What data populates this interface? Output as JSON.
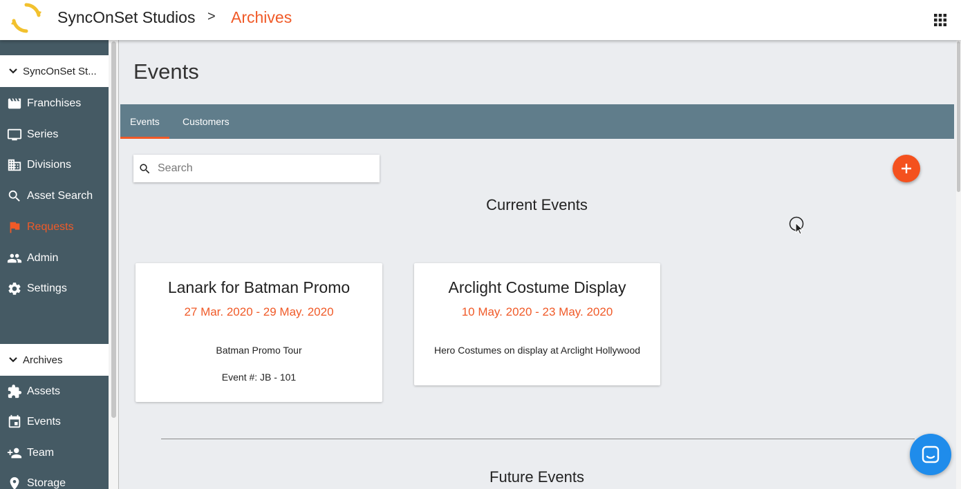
{
  "header": {
    "org_name": "SyncOnSet Studios",
    "separator": ">",
    "current_section": "Archives",
    "apps_icon": "apps-grid-icon",
    "accent_color": "#f05a28"
  },
  "sidebar": {
    "org_section": {
      "label": "SyncOnSet St...",
      "icon": "chevron-down-icon"
    },
    "main_items": [
      {
        "label": "Franchises",
        "icon": "clapperboard-icon"
      },
      {
        "label": "Series",
        "icon": "monitor-icon"
      },
      {
        "label": "Divisions",
        "icon": "building-icon"
      },
      {
        "label": "Asset Search",
        "icon": "search-icon"
      },
      {
        "label": "Requests",
        "icon": "flag-icon",
        "active": true
      },
      {
        "label": "Admin",
        "icon": "people-icon"
      },
      {
        "label": "Settings",
        "icon": "gear-icon"
      }
    ],
    "archives_section": {
      "label": "Archives",
      "icon": "chevron-down-icon"
    },
    "archive_items": [
      {
        "label": "Assets",
        "icon": "puzzle-icon"
      },
      {
        "label": "Events",
        "icon": "calendar-icon"
      },
      {
        "label": "Team",
        "icon": "add-person-icon"
      },
      {
        "label": "Storage",
        "icon": "location-pin-icon"
      }
    ],
    "background_color": "#455a64"
  },
  "main": {
    "title": "Events",
    "tabs": [
      {
        "label": "Events",
        "active": true
      },
      {
        "label": "Customers",
        "active": false
      }
    ],
    "search": {
      "placeholder": "Search",
      "value": ""
    },
    "add_button_icon": "plus-icon",
    "current_events_title": "Current Events",
    "events": [
      {
        "title": "Lanark for Batman Promo",
        "dates": "27 Mar. 2020 - 29 May. 2020",
        "description": "Batman Promo Tour",
        "event_number": "Event #: JB - 101"
      },
      {
        "title": "Arclight Costume Display",
        "dates": "10 May. 2020 - 23 May. 2020",
        "description": "Hero Costumes on display at Arclight Hollywood",
        "event_number": ""
      }
    ],
    "future_events_title": "Future Events",
    "tab_bar_color": "#607d8b",
    "fab_color": "#f4511e"
  },
  "chat": {
    "icon": "chat-icon",
    "color": "#1f8ceb"
  }
}
